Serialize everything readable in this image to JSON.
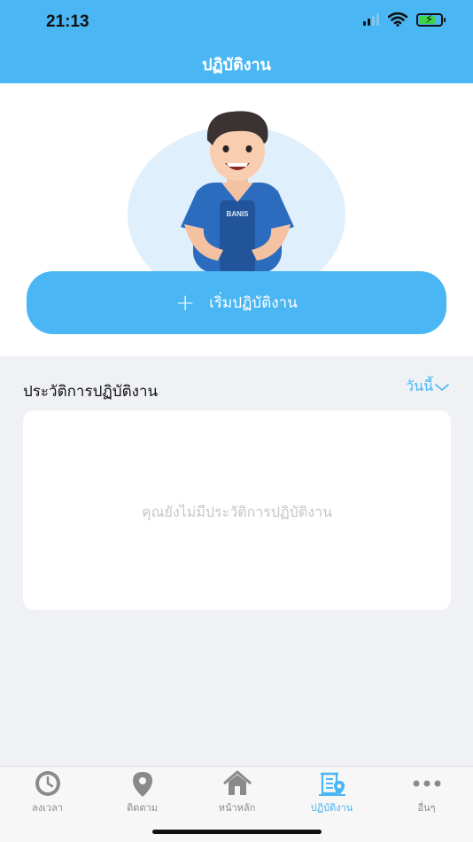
{
  "status_bar": {
    "time": "21:13"
  },
  "header": {
    "title": "ปฏิบัติงาน"
  },
  "hero": {
    "start_button_label": "เริ่มปฏิบัติงาน",
    "illustration_text": "BANIS"
  },
  "history": {
    "title": "ประวัติการปฏิบัติงาน",
    "filter_value": "วันนี้",
    "empty_message": "คุณยังไม่มีประวัติการปฏิบัติงาน"
  },
  "tabbar": {
    "items": [
      {
        "label": "ลงเวลา",
        "icon": "clock-icon"
      },
      {
        "label": "ติดตาม",
        "icon": "location-pin-icon"
      },
      {
        "label": "หน้าหลัก",
        "icon": "home-icon"
      },
      {
        "label": "ปฏิบัติงาน",
        "icon": "work-location-icon",
        "active": true
      },
      {
        "label": "อื่นๆ",
        "icon": "more-icon"
      }
    ]
  },
  "colors": {
    "accent": "#4ab6f3",
    "background": "#eff1f5",
    "muted_text": "#c4c6ca"
  }
}
